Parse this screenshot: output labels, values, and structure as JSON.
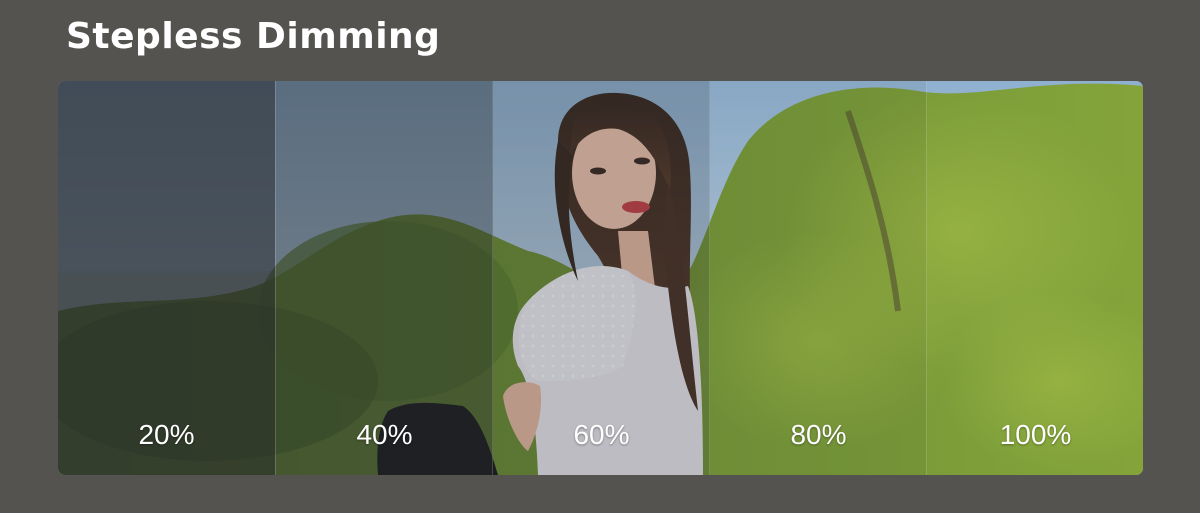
{
  "header": {
    "title": "Stepless Dimming"
  },
  "levels": [
    {
      "label": "20%",
      "darkness": 0.72
    },
    {
      "label": "40%",
      "darkness": 0.48
    },
    {
      "label": "60%",
      "darkness": 0.22
    },
    {
      "label": "80%",
      "darkness": 0.06
    },
    {
      "label": "100%",
      "darkness": 0.0
    }
  ],
  "colors": {
    "background": "#545350",
    "title": "#ffffff",
    "label": "#ffffff",
    "tint": "#22262a"
  }
}
